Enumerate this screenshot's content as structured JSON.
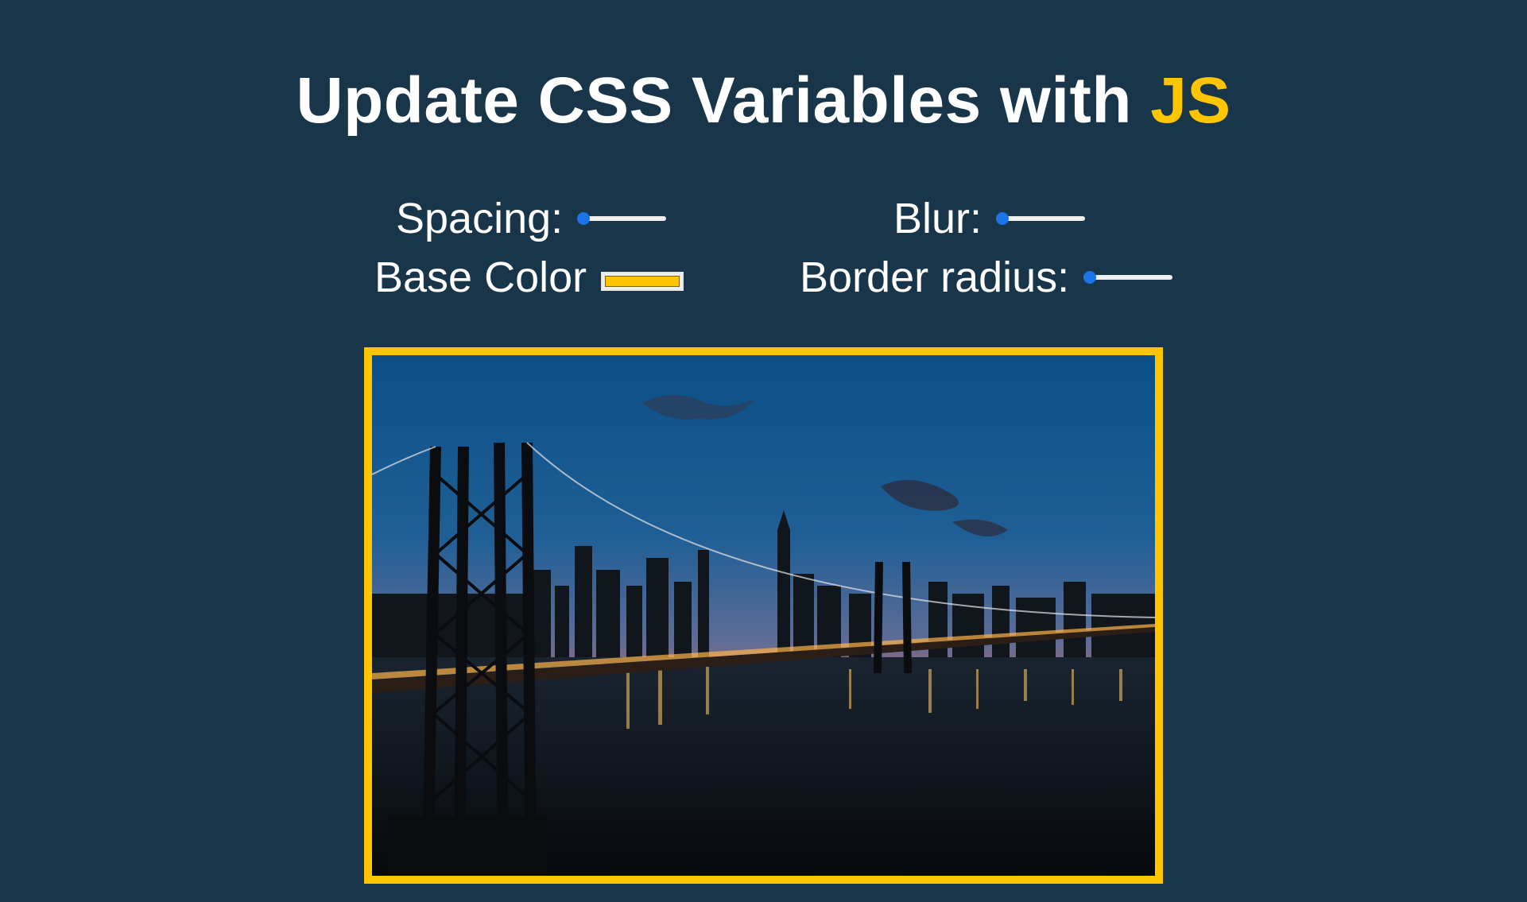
{
  "header": {
    "title_prefix": "Update CSS Variables with",
    "title_highlight": "JS"
  },
  "controls": {
    "spacing": {
      "label": "Spacing:",
      "value_fraction": 0.0
    },
    "blur": {
      "label": "Blur:",
      "value_fraction": 0.0
    },
    "base_color": {
      "label": "Base Color",
      "value": "#ffc600"
    },
    "border_radius": {
      "label": "Border radius:",
      "value_fraction": 0.0
    }
  },
  "colors": {
    "background": "#193549",
    "accent": "#ffc600",
    "slider": "#1a73e8"
  },
  "image": {
    "subject": "photo of a suspension bridge and city skyline at dusk"
  }
}
